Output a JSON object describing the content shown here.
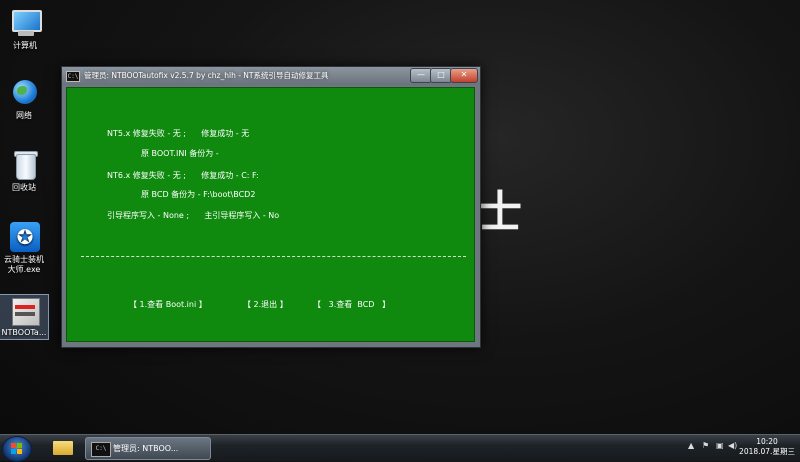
{
  "desktop": {
    "icons": [
      {
        "label": "计算机",
        "icon": "computer-icon"
      },
      {
        "label": "网络",
        "icon": "network-icon"
      },
      {
        "label": "回收站",
        "icon": "recycle-bin-icon"
      },
      {
        "label_line1": "云骑士装机",
        "label_line2": "大师.exe",
        "icon": "yunqishi-app-icon"
      },
      {
        "label": "NTBOOTa...",
        "icon": "ntboot-icon"
      }
    ],
    "wallpaper_text": "士"
  },
  "window": {
    "title": "管理员: NTBOOTautofix v2.5.7 by chz_hlh - NT系统引导自动修复工具",
    "controls": {
      "minimize": "—",
      "maximize": "□",
      "close": "✕"
    },
    "console": {
      "nt5_line": "NT5.x 修复失败 - 无 ;      修复成功 - 无",
      "boot_ini_line": "原 BOOT.INI 备份为 -",
      "nt6_line": "NT6.x 修复失败 - 无 ;      修复成功 - C: F:",
      "bcd_line": "原 BCD 备份为 - F:\\boot\\BCD2",
      "boot_write_line": "引导程序写入 - None ;      主引导程序写入 - No",
      "menu": [
        "【 1.查看 Boot.ini 】",
        "【 2.退出 】",
        "【   3.查看  BCD   】"
      ]
    }
  },
  "taskbar": {
    "task_label": "管理员: NTBOO...",
    "tray": {
      "chevron": "▲",
      "flag": "⚑",
      "network": "▣",
      "volume": "◀)"
    },
    "clock": {
      "time": "10:20",
      "date": "2018.07.星期三"
    }
  },
  "colors": {
    "console_bg": "#0f8a0f",
    "taskbar": "#1e2328",
    "desktop": "#141414"
  }
}
